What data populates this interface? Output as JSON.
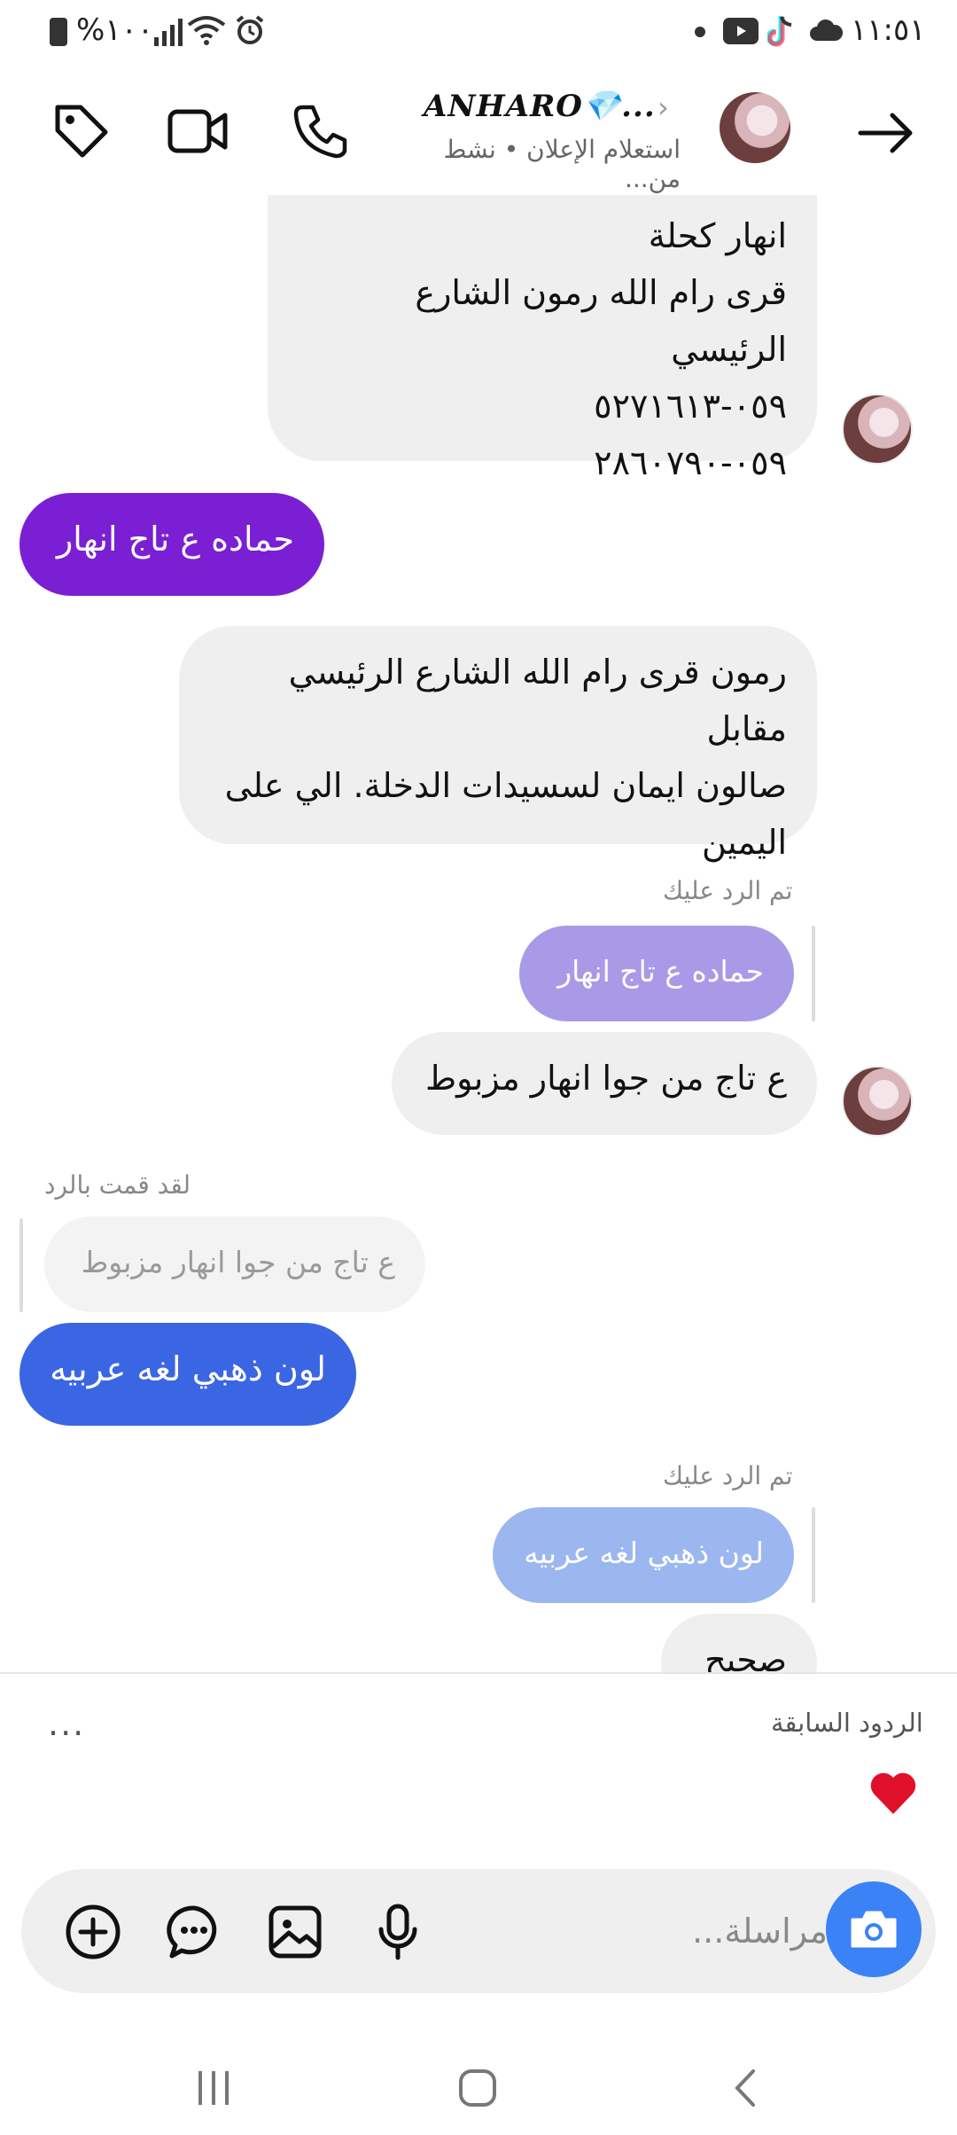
{
  "status_bar": {
    "time": "١١:٥١",
    "battery": "%١٠٠",
    "icons": [
      "battery-icon",
      "signal-icon",
      "wifi-icon",
      "alarm-icon",
      "dot-icon",
      "youtube-icon",
      "tiktok-icon",
      "cloud-icon"
    ]
  },
  "header": {
    "name": "ANHARO💎...",
    "subtitle": "استعلام الإعلان • نشط من...",
    "icons": [
      "tag-icon",
      "video-call-icon",
      "phone-icon",
      "forward-arrow-icon"
    ]
  },
  "messages": {
    "m1": {
      "line1": "انهار كحلة",
      "line2": "قرى رام الله رمون الشارع الرئيسي",
      "line3": "٠٥٩-٥٢٧١٦١٣",
      "line4": "٠٥٩-٢٨٦٠٧٩٠"
    },
    "m2": "حماده ع تاج انهار",
    "m3": {
      "line1": "رمون قرى رام الله الشارع الرئيسي مقابل",
      "line2": "صالون ايمان لسسيدات الدخلة. الي على",
      "line3": "اليمين"
    },
    "m4_meta": "تم الرد عليك",
    "m4_quote": "حماده ع تاج انهار",
    "m4_text": "ع تاج من جوا انهار مزبوط",
    "m5_meta": "لقد قمت بالرد",
    "m5_quote": "ع تاج من جوا انهار مزبوط",
    "m5_text": "لون ذهبي لغه عربيه",
    "m6_meta": "تم الرد عليك",
    "m6_quote": "لون ذهبي لغه عربيه",
    "m6_text": "صحيح"
  },
  "quick_replies": {
    "label": "الردود السابقة",
    "more": "...",
    "heart": "❤️"
  },
  "composer": {
    "placeholder": "مراسلة..."
  },
  "colors": {
    "purple": "#7a1fd3",
    "blue": "#3b66e3",
    "camera": "#3b82f6"
  }
}
